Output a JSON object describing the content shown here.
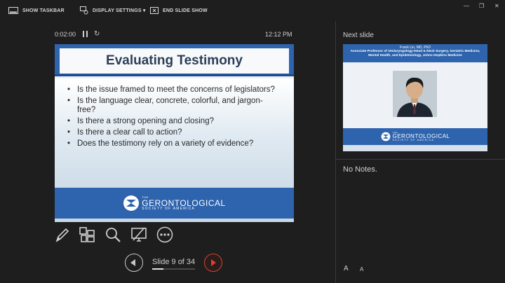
{
  "toolbar": {
    "show_taskbar": "SHOW TASKBAR",
    "display_settings": "DISPLAY SETTINGS ▾",
    "end_slide_show": "END SLIDE SHOW"
  },
  "window_controls": {
    "minimize": "—",
    "restore": "❐",
    "close": "✕"
  },
  "timer": {
    "elapsed": "0:02:00",
    "clock": "12:12 PM"
  },
  "current_slide": {
    "title": "Evaluating Testimony",
    "bullets": [
      "Is the issue framed to meet the concerns of legislators?",
      "Is the language clear, concrete, colorful, and jargon-free?",
      "Is there a strong opening and closing?",
      "Is there a clear call to action?",
      "Does the testimony rely on a variety of evidence?"
    ],
    "logo": {
      "the": "THE",
      "main": "GERONTOLOGICAL",
      "sub": "SOCIETY OF AMERICA"
    }
  },
  "tools": [
    {
      "name": "pen-tool",
      "icon": "pen-icon"
    },
    {
      "name": "see-all-slides",
      "icon": "grid-icon"
    },
    {
      "name": "zoom-into-slide",
      "icon": "magnifier-icon"
    },
    {
      "name": "black-screen",
      "icon": "screen-slash-icon"
    },
    {
      "name": "more-options",
      "icon": "ellipsis-icon"
    }
  ],
  "navigation": {
    "counter": "Slide 9 of 34",
    "current": 9,
    "total": 34
  },
  "next_slide": {
    "label": "Next slide",
    "name": "Frank Lin, MD, PhD",
    "title": "Associate Professor of Otolaryngology-Head & Neck Surgery, Geriatric Medicine, Mental Health, and Epidemiology, Johns Hopkins Medicine",
    "logo": {
      "the": "THE",
      "main": "GERONTOLOGICAL",
      "sub": "SOCIETY OF AMERICA"
    }
  },
  "notes": {
    "text": "No Notes."
  },
  "font_controls": {
    "increase": "A",
    "decrease": "A"
  }
}
